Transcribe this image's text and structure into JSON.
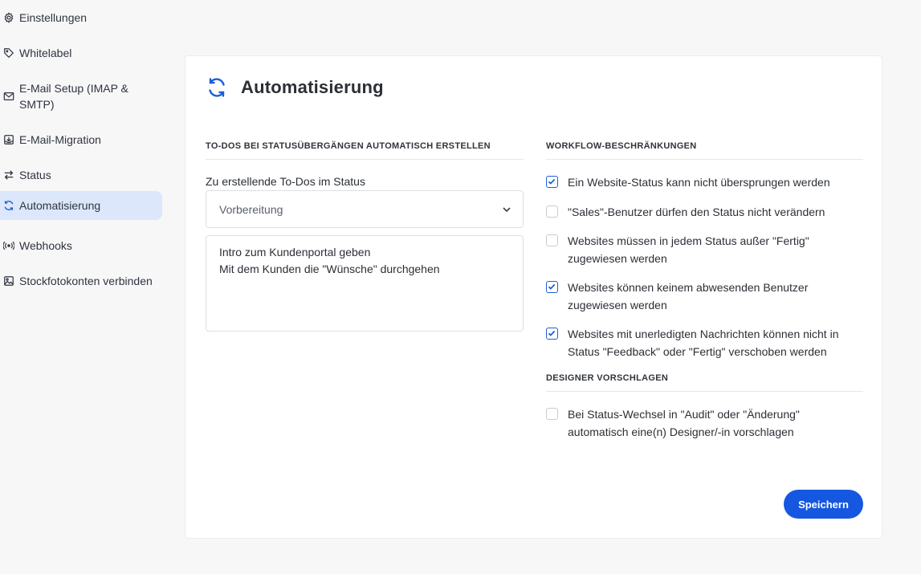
{
  "sidebar": {
    "items": [
      {
        "label": "Einstellungen",
        "icon": "gear-icon"
      },
      {
        "label": "Whitelabel",
        "icon": "tag-icon"
      },
      {
        "label": "E-Mail Setup (IMAP & SMTP)",
        "icon": "mail-icon"
      },
      {
        "label": "E-Mail-Migration",
        "icon": "inbox-download-icon"
      },
      {
        "label": "Status",
        "icon": "swap-arrows-icon"
      },
      {
        "label": "Automatisierung",
        "icon": "refresh-icon",
        "active": true
      },
      {
        "label": "Webhooks",
        "icon": "webhook-icon"
      },
      {
        "label": "Stockfotokonten verbinden",
        "icon": "image-icon"
      }
    ]
  },
  "page": {
    "title": "Automatisierung",
    "accent_color": "#1557e0"
  },
  "todos": {
    "heading": "TO-DOS BEI STATUSÜBERGÄNGEN AUTOMATISCH ERSTELLEN",
    "status_label": "Zu erstellende To-Dos im Status",
    "selected_status": "Vorbereitung",
    "todo_text": "Intro zum Kundenportal geben\nMit dem Kunden die \"Wünsche\" durchgehen"
  },
  "workflow": {
    "heading": "WORKFLOW-BESCHRÄNKUNGEN",
    "options": [
      {
        "label": "Ein Website-Status kann nicht übersprungen werden",
        "checked": true
      },
      {
        "label": "\"Sales\"-Benutzer dürfen den Status nicht verändern",
        "checked": false
      },
      {
        "label": "Websites müssen in jedem Status außer \"Fertig\" zugewiesen werden",
        "checked": false
      },
      {
        "label": "Websites können keinem abwesenden Benutzer zugewiesen werden",
        "checked": true
      },
      {
        "label": "Websites mit unerledigten Nachrichten können nicht in Status \"Feedback\" oder \"Fertig\" verschoben werden",
        "checked": true
      }
    ]
  },
  "designer": {
    "heading": "DESIGNER VORSCHLAGEN",
    "options": [
      {
        "label": "Bei Status-Wechsel in \"Audit\" oder \"Änderung\" automatisch eine(n) Designer/-in vorschlagen",
        "checked": false
      }
    ]
  },
  "actions": {
    "save_label": "Speichern"
  }
}
